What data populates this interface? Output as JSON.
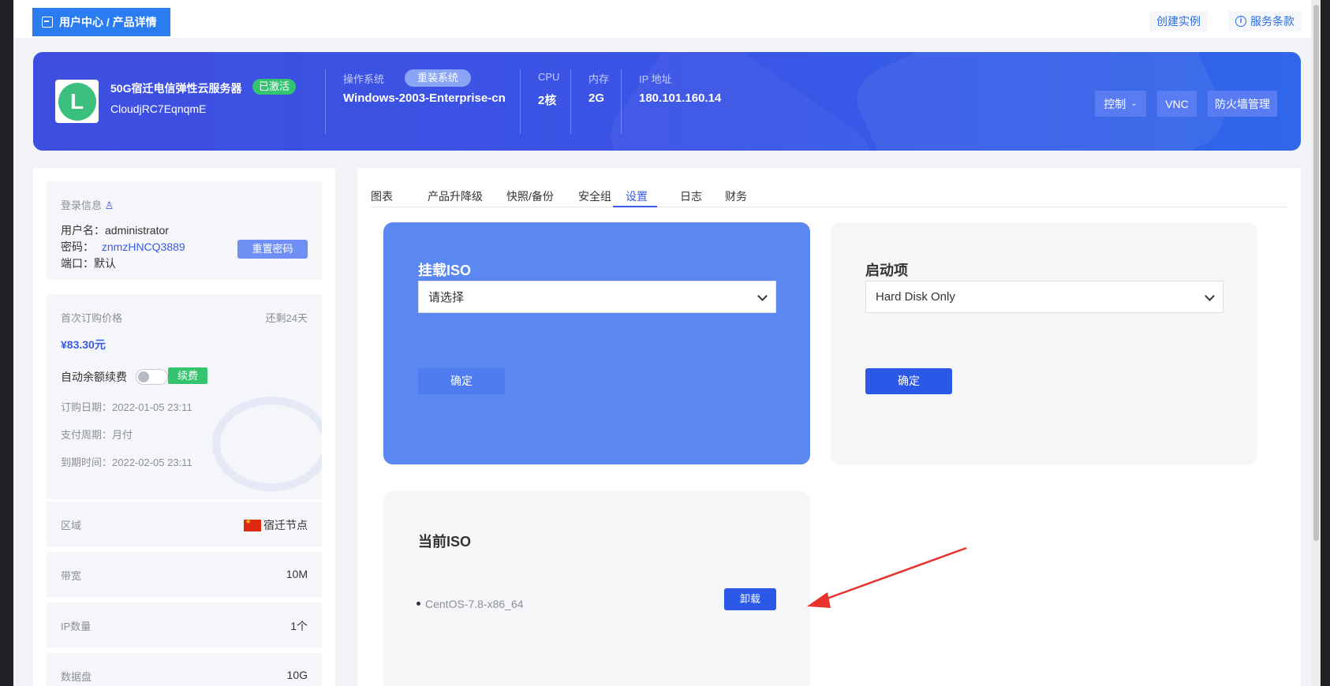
{
  "header": {
    "breadcrumb": "用户中心 / 产品详情",
    "create_instance": "创建实例",
    "service_terms": "服务条款"
  },
  "product": {
    "name": "50G宿迁电信弹性云服务器",
    "status": "已激活",
    "id": "CloudjRC7EqnqmE",
    "avatar_letter": "L",
    "os_label": "操作系统",
    "reinstall_label": "重装系统",
    "os_value": "Windows-2003-Enterprise-cn",
    "cpu_label": "CPU",
    "cpu_value": "2核",
    "mem_label": "内存",
    "mem_value": "2G",
    "ip_label": "IP 地址",
    "ip_value": "180.101.160.14",
    "btn_control": "控制",
    "btn_vnc": "VNC",
    "btn_firewall": "防火墙管理"
  },
  "login": {
    "title": "登录信息",
    "username_label": "用户名：",
    "username": "administrator",
    "password_label": "密码：",
    "password": "znmzHNCQ3889",
    "port_label": "端口：",
    "port": "默认",
    "reset_btn": "重置密码"
  },
  "billing": {
    "first_price_label": "首次订购价格",
    "remaining": "还剩24天",
    "price": "¥83.30元",
    "auto_renew_label": "自动余额续费",
    "renew_btn": "续费",
    "order_date": "订购日期：2022-01-05 23:11",
    "pay_cycle": "支付周期：月付",
    "expire_date": "到期时间：2022-02-05 23:11"
  },
  "specs": [
    {
      "label": "区域",
      "value": "宿迁节点"
    },
    {
      "label": "带宽",
      "value": "10M"
    },
    {
      "label": "IP数量",
      "value": "1个"
    },
    {
      "label": "数据盘",
      "value": "10G"
    }
  ],
  "tabs": [
    "图表",
    "产品升降级",
    "快照/备份",
    "安全组",
    "设置",
    "日志",
    "财务"
  ],
  "active_tab": "设置",
  "mount_iso": {
    "title": "挂载ISO",
    "placeholder": "请选择",
    "confirm": "确定"
  },
  "boot": {
    "title": "启动项",
    "value": "Hard Disk Only",
    "confirm": "确定"
  },
  "current_iso": {
    "title": "当前ISO",
    "name": "CentOS-7.8-x86_64",
    "unmount": "卸载"
  },
  "colors": {
    "primary": "#3b5ae6",
    "banner": "#3a55e6",
    "success": "#34c46f",
    "annotation": "#e8322e"
  }
}
